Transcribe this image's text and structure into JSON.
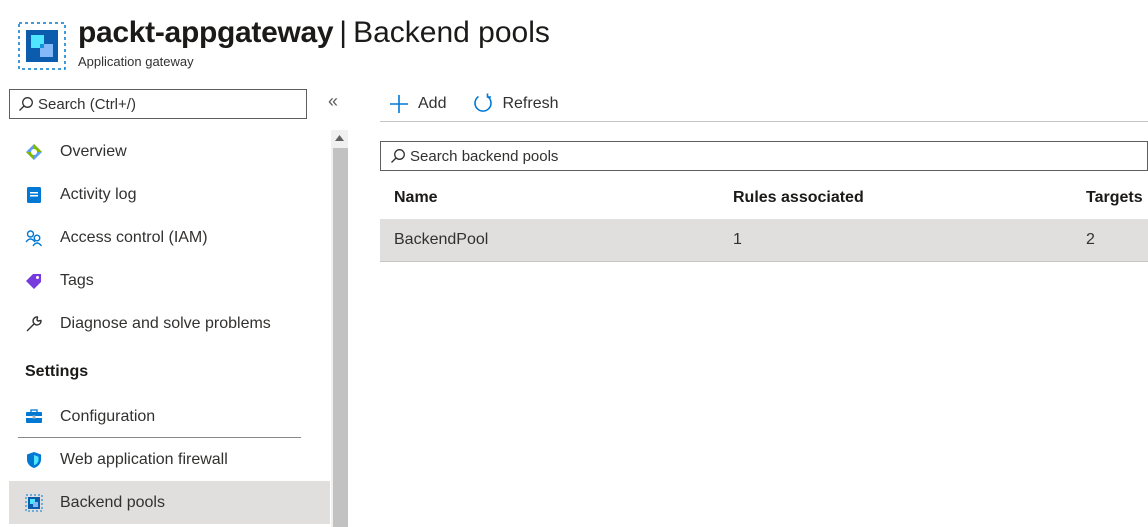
{
  "header": {
    "resource_name": "packt-appgateway",
    "separator": "|",
    "page_title": "Backend pools",
    "resource_type": "Application gateway",
    "icon": "application-gateway-icon"
  },
  "sidebar": {
    "search_placeholder": "Search (Ctrl+/)",
    "collapse_glyph": "«",
    "items": [
      {
        "label": "Overview",
        "icon": "overview-icon"
      },
      {
        "label": "Activity log",
        "icon": "activity-log-icon"
      },
      {
        "label": "Access control (IAM)",
        "icon": "iam-icon"
      },
      {
        "label": "Tags",
        "icon": "tag-icon"
      },
      {
        "label": "Diagnose and solve problems",
        "icon": "wrench-icon"
      }
    ],
    "settings_heading": "Settings",
    "settings_items": [
      {
        "label": "Configuration",
        "icon": "configuration-icon"
      },
      {
        "label": "Web application firewall",
        "icon": "shield-icon"
      },
      {
        "label": "Backend pools",
        "icon": "backend-pools-icon",
        "selected": true
      }
    ]
  },
  "toolbar": {
    "add_label": "Add",
    "refresh_label": "Refresh"
  },
  "pools": {
    "search_placeholder": "Search backend pools",
    "columns": [
      "Name",
      "Rules associated",
      "Targets"
    ],
    "rows": [
      {
        "name": "BackendPool",
        "rules": "1",
        "targets": "2"
      }
    ]
  },
  "colors": {
    "accent": "#0078d4",
    "selected_bg": "#e1dfdd",
    "text": "#323130"
  }
}
